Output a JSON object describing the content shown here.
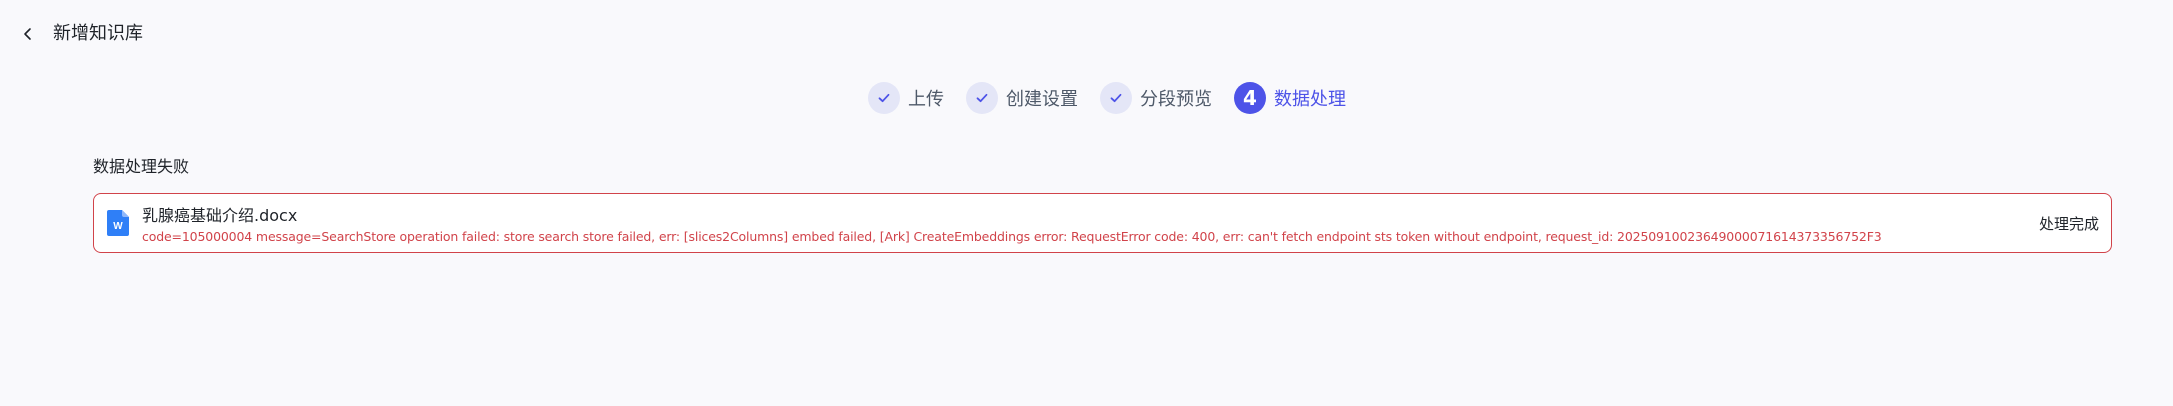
{
  "header": {
    "title": "新增知识库",
    "back_icon": "chevron-left-icon"
  },
  "steps": [
    {
      "label": "上传",
      "state": "done",
      "icon": "check-icon"
    },
    {
      "label": "创建设置",
      "state": "done",
      "icon": "check-icon"
    },
    {
      "label": "分段预览",
      "state": "done",
      "icon": "check-icon"
    },
    {
      "label": "数据处理",
      "state": "active",
      "number": "4"
    }
  ],
  "section": {
    "title": "数据处理失败"
  },
  "file": {
    "icon": "word-doc-icon",
    "icon_letter": "W",
    "name": "乳腺癌基础介绍.docx",
    "error": "code=105000004 message=SearchStore operation failed: store search store failed, err: [slices2Columns] embed failed, [Ark] CreateEmbeddings error: RequestError code: 400, err: can't fetch endpoint sts token without endpoint, request_id: 20250910023649000071614373356752F3",
    "status": "处理完成"
  },
  "colors": {
    "accent": "#4d53e8",
    "error": "#d1434a",
    "done_circle": "#e4e6f7",
    "background": "#f9f9fc",
    "doc_icon": "#2f7ff7"
  }
}
